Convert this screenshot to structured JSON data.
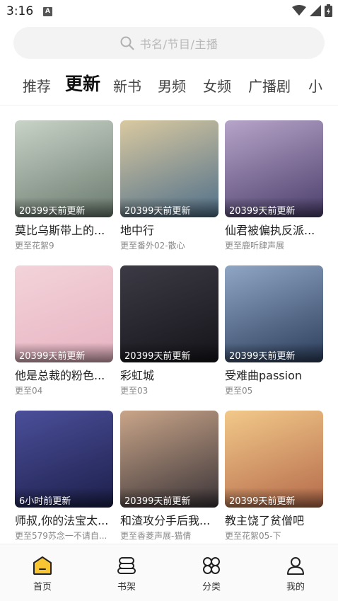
{
  "status": {
    "time": "3:16",
    "indicator": "A"
  },
  "search": {
    "placeholder": "书名/节目/主播"
  },
  "tabs": [
    {
      "label": "推荐",
      "active": false
    },
    {
      "label": "更新",
      "active": true
    },
    {
      "label": "新书",
      "active": false
    },
    {
      "label": "男频",
      "active": false
    },
    {
      "label": "女频",
      "active": false
    },
    {
      "label": "广播剧",
      "active": false
    },
    {
      "label": "小",
      "active": false
    }
  ],
  "cards": [
    {
      "badge": "20399天前更新",
      "title": "莫比乌斯带上的...",
      "subtitle": "更至花絮9",
      "colors": [
        "#c9d3c8",
        "#6a7a6e"
      ]
    },
    {
      "badge": "20399天前更新",
      "title": "地中行",
      "subtitle": "更至番外02-散心",
      "colors": [
        "#d9c9a0",
        "#4f6f8a"
      ]
    },
    {
      "badge": "20399天前更新",
      "title": "仙君被偏执反派...",
      "subtitle": "更至鹿听肆声展",
      "colors": [
        "#b7a4c9",
        "#4a3e6b"
      ]
    },
    {
      "badge": "20399天前更新",
      "title": "他是总裁的粉色...",
      "subtitle": "更至04",
      "colors": [
        "#f3d3da",
        "#e7b3c2"
      ]
    },
    {
      "badge": "20399天前更新",
      "title": "彩虹城",
      "subtitle": "更至03",
      "colors": [
        "#3c3a44",
        "#15141a"
      ]
    },
    {
      "badge": "20399天前更新",
      "title": "受难曲passion",
      "subtitle": "更至05",
      "colors": [
        "#8fa6c4",
        "#2c3e5c"
      ]
    },
    {
      "badge": "6小时前更新",
      "title": "师叔,你的法宝太...",
      "subtitle": "更至579苏念一不请自...",
      "colors": [
        "#4b4f9a",
        "#1c1f4a"
      ]
    },
    {
      "badge": "20399天前更新",
      "title": "和渣攻分手后我...",
      "subtitle": "更至香菱声展-猫倩",
      "colors": [
        "#c9a589",
        "#3b3438"
      ]
    },
    {
      "badge": "20399天前更新",
      "title": "教主饶了贫僧吧",
      "subtitle": "更至花絮05-下",
      "colors": [
        "#f2c98a",
        "#b56a4a"
      ]
    }
  ],
  "nav": [
    {
      "label": "首页",
      "icon": "home-icon",
      "active": true
    },
    {
      "label": "书架",
      "icon": "bookshelf-icon",
      "active": false
    },
    {
      "label": "分类",
      "icon": "category-icon",
      "active": false
    },
    {
      "label": "我的",
      "icon": "profile-icon",
      "active": false
    }
  ],
  "colors": {
    "accent": "#f7c632",
    "text": "#222222",
    "muted": "#888888"
  }
}
